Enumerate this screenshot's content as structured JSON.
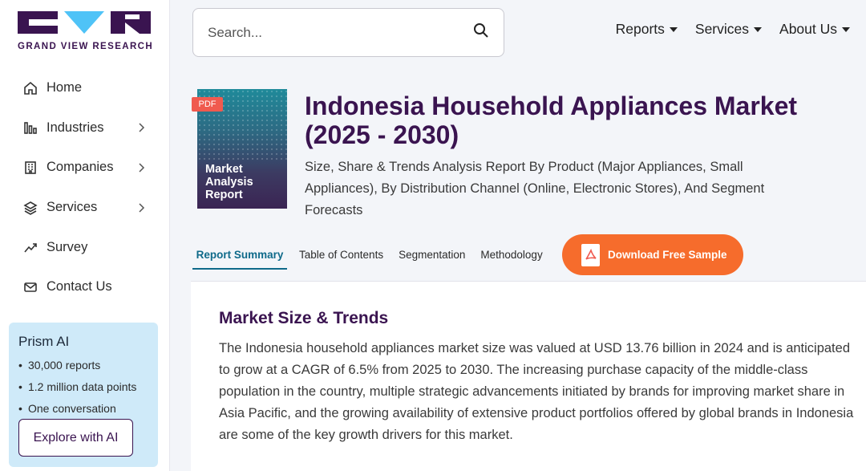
{
  "brand": {
    "name": "GRAND VIEW RESEARCH",
    "primary_color": "#3a1450",
    "accent_color": "#f66c2c"
  },
  "sidebar": {
    "items": [
      {
        "label": "Home",
        "icon": "home-icon",
        "has_chevron": false
      },
      {
        "label": "Industries",
        "icon": "bar-chart-icon",
        "has_chevron": true
      },
      {
        "label": "Companies",
        "icon": "building-icon",
        "has_chevron": true
      },
      {
        "label": "Services",
        "icon": "layers-icon",
        "has_chevron": true
      },
      {
        "label": "Survey",
        "icon": "trend-icon",
        "has_chevron": false
      },
      {
        "label": "Contact Us",
        "icon": "mail-icon",
        "has_chevron": false
      }
    ],
    "prism": {
      "title": "Prism AI",
      "points": [
        "30,000 reports",
        "1.2 million data points",
        "One conversation"
      ],
      "button": "Explore with AI"
    }
  },
  "search": {
    "placeholder": "Search..."
  },
  "topnav": {
    "items": [
      "Reports",
      "Services",
      "About Us"
    ]
  },
  "report": {
    "badge": "PDF",
    "cover_text": [
      "Market",
      "Analysis",
      "Report"
    ],
    "title": "Indonesia Household Appliances Market (2025 - 2030)",
    "subtitle": "Size, Share & Trends Analysis Report By Product (Major Appliances, Small Appliances), By Distribution Channel (Online, Electronic Stores), And Segment Forecasts"
  },
  "tabs": {
    "items": [
      "Report Summary",
      "Table of Contents",
      "Segmentation",
      "Methodology"
    ],
    "active": "Report Summary",
    "download": "Download Free Sample"
  },
  "content": {
    "heading": "Market Size & Trends",
    "body": "The Indonesia household appliances market size was valued at USD 13.76 billion in 2024 and is anticipated to grow at a CAGR of 6.5% from 2025 to 2030. The increasing purchase capacity of the middle-class population in the country, multiple strategic advancements initiated by brands for improving market share in Asia Pacific, and the growing availability of extensive product portfolios offered by global brands in Indonesia are some of the key growth drivers for this market."
  }
}
